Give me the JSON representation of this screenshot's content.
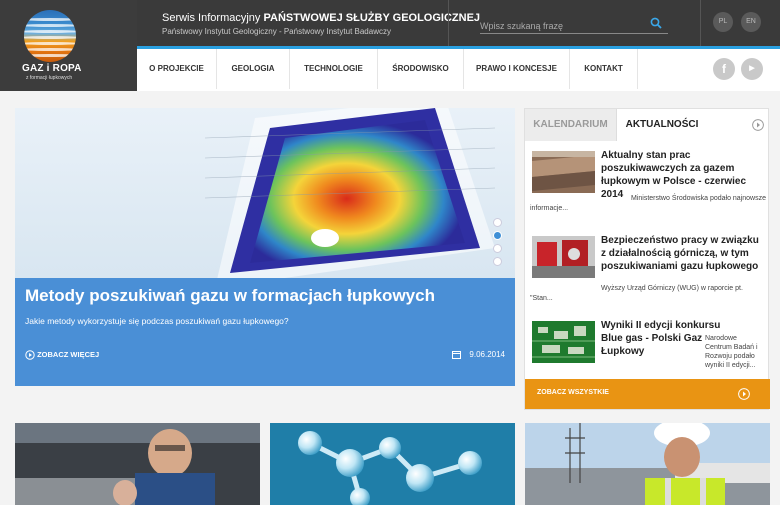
{
  "logo": {
    "title": "GAZ i ROPA",
    "subtitle": "z formacji łupkowych"
  },
  "header": {
    "title_prefix": "Serwis Informacyjny ",
    "title_bold": "PAŃSTWOWEJ SŁUŻBY GEOLOGICZNEJ",
    "subtitle": "Państwowy Instytut Geologiczny - Państwowy Instytut Badawczy",
    "search_placeholder": "Wpisz szukaną frazę",
    "languages": [
      "PL",
      "EN"
    ]
  },
  "nav": {
    "items": [
      "O PROJEKCIE",
      "GEOLOGIA",
      "TECHNOLOGIE",
      "ŚRODOWISKO",
      "PRAWO I KONCESJE",
      "KONTAKT"
    ]
  },
  "hero": {
    "title": "Metody poszukiwań gazu w formacjach łupkowych",
    "text": "Jakie metody wykorzystuje się podczas poszukiwań gazu łupkowego?",
    "more": "ZOBACZ WIĘCEJ",
    "date": "9.06.2014",
    "slides": 4,
    "active_slide": 2
  },
  "sidebar": {
    "tabs": [
      "KALENDARIUM",
      "AKTUALNOŚCI"
    ],
    "active_tab": "AKTUALNOŚCI",
    "news": [
      {
        "title": "Aktualny stan prac poszukiwawczych za gazem łupkowym w Polsce - czerwiec 2014",
        "text_right": "Ministerstwo Środowiska podało najnowsze",
        "text": "informacje..."
      },
      {
        "title": "Bezpieczeństwo pracy w związku z działalnością górniczą, w tym poszukiwaniami gazu łupkowego",
        "text_right": "Wyższy Urząd Górniczy (WUG) w raporcie pt.",
        "text": "\"Stan..."
      },
      {
        "title": "Wyniki II edycji konkursu Blue gas - Polski Gaz Łupkowy",
        "text_right": "Narodowe Centrum Badań i Rozwoju podało wyniki II edycji..."
      }
    ],
    "see_all": "ZOBACZ WSZYSTKIE"
  },
  "colors": {
    "accent": "#2aa0e0",
    "hero_panel": "#4a8fd6",
    "orange": "#e99413",
    "dark": "#3a3a3a"
  }
}
